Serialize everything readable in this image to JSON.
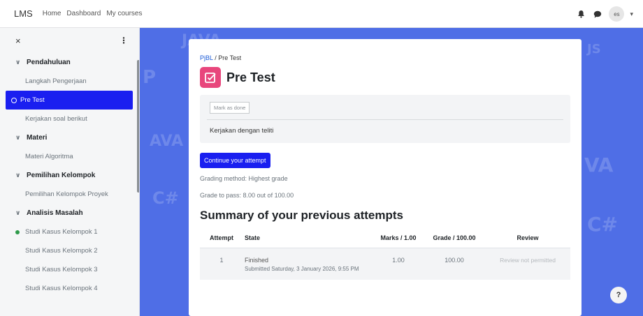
{
  "topnav": {
    "brand": "LMS",
    "links": [
      "Home",
      "Dashboard",
      "My courses"
    ],
    "avatar_initials": "es"
  },
  "sidebar": {
    "close_glyph": "×",
    "menu_glyph": "⋮",
    "items": [
      {
        "type": "section",
        "label": "Pendahuluan"
      },
      {
        "type": "item",
        "label": "Langkah Pengerjaan"
      },
      {
        "type": "active",
        "label": "Pre Test"
      },
      {
        "type": "item",
        "label": "Kerjakan soal berikut"
      },
      {
        "type": "section",
        "label": "Materi"
      },
      {
        "type": "item",
        "label": "Materi Algoritma"
      },
      {
        "type": "section",
        "label": "Pemilihan Kelompok"
      },
      {
        "type": "item",
        "label": "Pemilihan Kelompok Proyek"
      },
      {
        "type": "section",
        "label": "Analisis Masalah"
      },
      {
        "type": "done",
        "label": "Studi Kasus Kelompok 1"
      },
      {
        "type": "item",
        "label": "Studi Kasus Kelompok 2"
      },
      {
        "type": "item",
        "label": "Studi Kasus Kelompok 3"
      },
      {
        "type": "item",
        "label": "Studi Kasus Kelompok 4"
      }
    ]
  },
  "main": {
    "breadcrumb": {
      "course": "PjBL",
      "separator": "/",
      "current": "Pre Test"
    },
    "title": "Pre Test",
    "mark_done_label": "Mark as done",
    "intro_text": "Kerjakan dengan teliti",
    "continue_label": "Continue your attempt",
    "grading_method": "Grading method: Highest grade",
    "grade_to_pass": "Grade to pass: 8.00 out of 100.00",
    "summary_title": "Summary of your previous attempts",
    "table": {
      "headers": [
        "Attempt",
        "State",
        "Marks / 1.00",
        "Grade / 100.00",
        "Review"
      ],
      "rows": [
        {
          "attempt": "1",
          "state": "Finished",
          "submitted": "Submitted Saturday, 3 January 2026, 9:55 PM",
          "marks": "1.00",
          "grade": "100.00",
          "review": "Review not permitted"
        }
      ]
    }
  },
  "help_label": "?",
  "colors": {
    "accent": "#1a1ff0",
    "background": "#4f6ee6",
    "quiz_icon": "#e8467c",
    "done_dot": "#2e9a4a"
  },
  "icons": [
    "close-icon",
    "kebab-menu-icon",
    "bell-icon",
    "chat-icon",
    "chevron-down-icon",
    "quiz-icon",
    "help-icon"
  ]
}
